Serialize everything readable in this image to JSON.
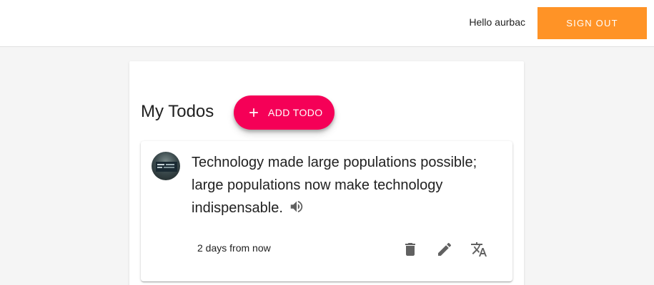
{
  "header": {
    "greeting": "Hello aurbac",
    "sign_out_label": "SIGN OUT"
  },
  "main": {
    "title": "My Todos",
    "add_label": "ADD TODO"
  },
  "todos": [
    {
      "text": "Technology made large populations possible; large populations now make technology indispensable.",
      "due": "2 days from now",
      "actions": [
        "delete-icon",
        "edit-icon",
        "translate-icon"
      ]
    }
  ],
  "colors": {
    "accent_orange": "#ff9326",
    "accent_pink": "#f50057",
    "icon_gray": "#616161"
  }
}
